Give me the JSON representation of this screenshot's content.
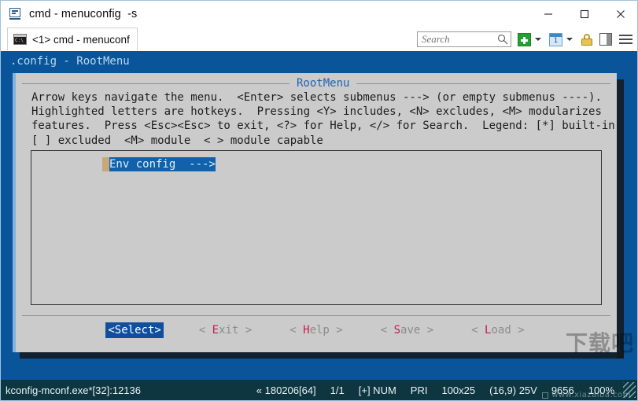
{
  "window": {
    "title": "cmd - menuconfig  -s",
    "icon": "console-app-icon",
    "minimize_label": "—",
    "maximize_label": "□",
    "close_label": "×"
  },
  "tabs": [
    {
      "label": "<1> cmd - menuconf",
      "icon": "console-icon",
      "prompt": "C:\\"
    }
  ],
  "toolbar": {
    "search": {
      "placeholder": "Search",
      "value": "",
      "icon": "search-icon"
    },
    "new_tab": {
      "icon": "plus-icon",
      "label": "+"
    },
    "tab_number": {
      "icon": "window-number-icon",
      "label": "1"
    },
    "lock": {
      "icon": "lock-icon"
    },
    "split_pane": {
      "icon": "split-pane-icon"
    },
    "menu": {
      "icon": "hamburger-menu-icon"
    }
  },
  "console": {
    "header": ".config - RootMenu",
    "dialog": {
      "title": "RootMenu",
      "help_text": "Arrow keys navigate the menu.  <Enter> selects submenus ---> (or empty submenus ----).\nHighlighted letters are hotkeys.  Pressing <Y> includes, <N> excludes, <M> modularizes\nfeatures.  Press <Esc><Esc> to exit, <?> for Help, </> for Search.  Legend: [*] built-in\n[ ] excluded  <M> module  < > module capable",
      "list_items": [
        {
          "label": "Env config  --->",
          "selected": true,
          "cursor": true
        }
      ],
      "buttons": [
        {
          "label": "<Select>",
          "active": true,
          "hotkey": "S",
          "pre": "<Select>",
          "post": ""
        },
        {
          "label": "< Exit >",
          "active": false,
          "pre": "< ",
          "hotkey": "E",
          "post": "xit >"
        },
        {
          "label": "< Help >",
          "active": false,
          "pre": "< ",
          "hotkey": "H",
          "post": "elp >"
        },
        {
          "label": "< Save >",
          "active": false,
          "pre": "< ",
          "hotkey": "S",
          "post": "ave >"
        },
        {
          "label": "< Load >",
          "active": false,
          "pre": "< ",
          "hotkey": "L",
          "post": "oad >"
        }
      ]
    }
  },
  "statusbar": {
    "process": "kconfig-mconf.exe*[32]:12136",
    "cells": [
      "« 180206[64]",
      "1/1",
      "[+] NUM",
      "PRI",
      "100x25",
      "(16,9) 25V",
      "9656",
      "100%"
    ]
  },
  "watermark": {
    "big": "下载吧",
    "small": "www.xiazaiba.com"
  },
  "colors": {
    "console_bg": "#0a559a",
    "dialog_bg": "#cbcbcb",
    "highlight": "#0f62ab",
    "cursor": "#c8a878",
    "hotkey": "#c61c4e",
    "status_bg": "#0d3640",
    "title_accent": "#1f63b0"
  }
}
